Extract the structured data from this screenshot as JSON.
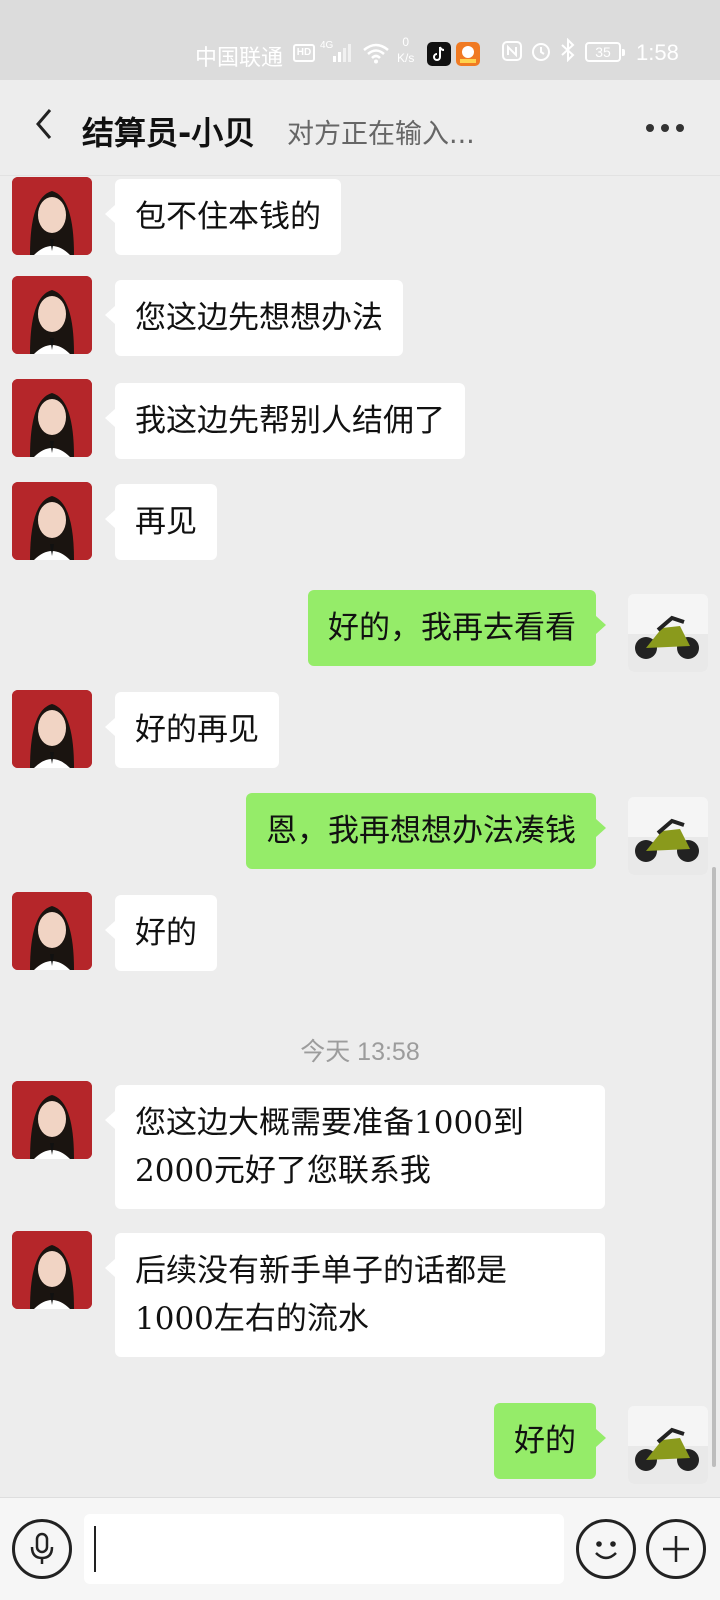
{
  "status_bar": {
    "carrier": "中国联通",
    "hd": "HD",
    "network": "4G",
    "speed_value": "0",
    "speed_unit": "K/s",
    "battery": "35",
    "time": "1:58"
  },
  "header": {
    "back_icon": "chevron-left-icon",
    "title": "结算员-小贝",
    "typing_status": "对方正在输入...",
    "more_icon": "more-dots-icon"
  },
  "messages": [
    {
      "side": "left",
      "text": "包不住本钱的"
    },
    {
      "side": "left",
      "text": "您这边先想想办法"
    },
    {
      "side": "left",
      "text": "我这边先帮别人结佣了"
    },
    {
      "side": "left",
      "text": "再见"
    },
    {
      "side": "right",
      "text": "好的，我再去看看"
    },
    {
      "side": "left",
      "text": "好的再见"
    },
    {
      "side": "right",
      "text": "恩，我再想想办法凑钱"
    },
    {
      "side": "left",
      "text": "好的"
    },
    {
      "side": "left",
      "text": "您这边大概需要准备1000到2000元好了您联系我"
    },
    {
      "side": "left",
      "text": "后续没有新手单子的话都是1000左右的流水"
    },
    {
      "side": "right",
      "text": "好的"
    }
  ],
  "timestamp": "今天 13:58",
  "input_bar": {
    "voice_icon": "microphone-icon",
    "input_value": "",
    "emoji_icon": "smiley-icon",
    "add_icon": "plus-icon"
  },
  "colors": {
    "background": "#ededed",
    "self_bubble": "#95ec69",
    "other_bubble": "#ffffff",
    "status_bar": "#dcdcdc"
  }
}
